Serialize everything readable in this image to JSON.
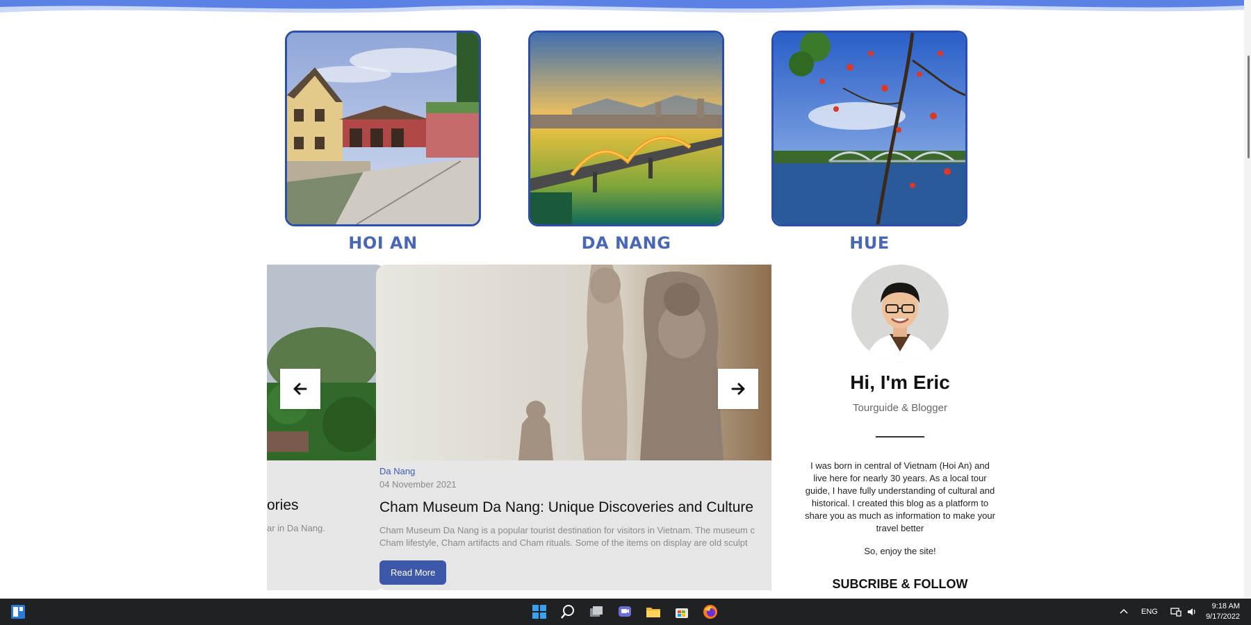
{
  "cities": [
    {
      "name": "HOI AN"
    },
    {
      "name": "DA NANG"
    },
    {
      "name": "HUE"
    }
  ],
  "carousel": {
    "prev_slide": {
      "title_fragment": "ories",
      "excerpt_fragment": "ar in Da Nang."
    },
    "main_slide": {
      "category": "Da Nang",
      "date": "04 November 2021",
      "title": "Cham Museum Da Nang: Unique Discoveries and Culture",
      "excerpt_line1": "Cham Museum Da Nang is a popular tourist destination for visitors in Vietnam. The museum c",
      "excerpt_line2": "Cham lifestyle, Cham artifacts and Cham rituals. Some of the items on display are old sculpt",
      "button": "Read More"
    }
  },
  "author": {
    "name": "Hi, I'm Eric",
    "role": "Tourguide & Blogger",
    "bio": "I was born in central of Vietnam (Hoi An) and live here for nearly 30 years. As a local tour guide, I have fully understanding of cultural and historical. I created this blog as a platform to share you as much as information to make your travel better",
    "enjoy": "So, enjoy the site!",
    "subscribe": "SUBCRIBE & FOLLOW"
  },
  "taskbar": {
    "language": "ENG",
    "time": "9:18 AM",
    "date": "9/17/2022"
  },
  "colors": {
    "accent": "#3d58a8",
    "city_label": "#4a67b5",
    "taskbar": "#1f2123"
  }
}
